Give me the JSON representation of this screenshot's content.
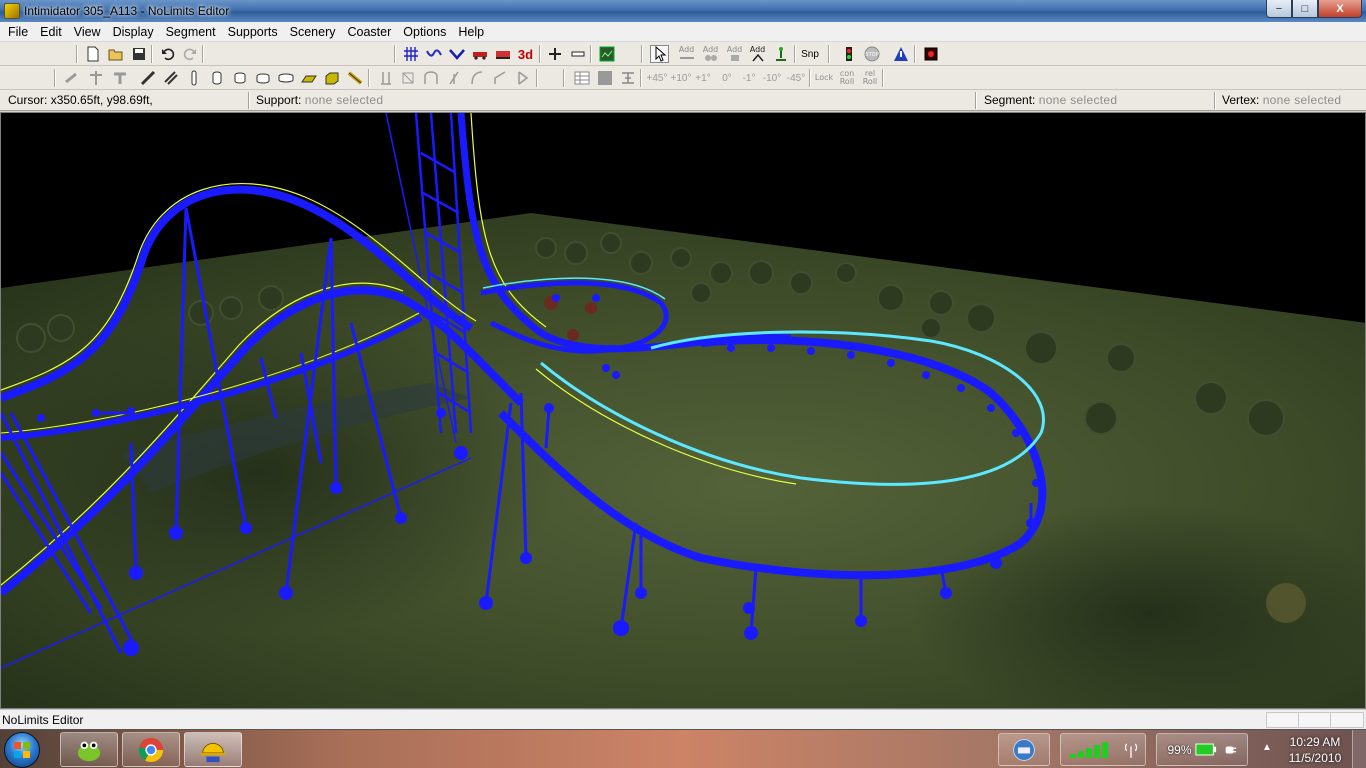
{
  "window": {
    "title": "Intimidator 305_A113 - NoLimits Editor",
    "controls": {
      "minimize": "−",
      "maximize": "□",
      "close": "X"
    }
  },
  "menu": [
    "File",
    "Edit",
    "View",
    "Display",
    "Segment",
    "Supports",
    "Scenery",
    "Coaster",
    "Options",
    "Help"
  ],
  "toolbar1": {
    "threed_label": "3d",
    "snp_label": "Snp",
    "add_labels": [
      "Add",
      "Add",
      "Add",
      "Add"
    ]
  },
  "toolbar2": {
    "angles": [
      "+45°",
      "+10°",
      "+1°",
      "0°",
      "-1°",
      "-10°",
      "-45°"
    ],
    "lock_label": "Lock",
    "con_roll_label": "con Roll",
    "rel_roll_label": "rel Roll"
  },
  "info": {
    "cursor_label": "Cursor:",
    "cursor_value": "x350.65ft, y98.69ft,",
    "support_label": "Support:",
    "support_value": "none selected",
    "segment_label": "Segment:",
    "segment_value": "none selected",
    "vertex_label": "Vertex:",
    "vertex_value": "none selected"
  },
  "status": {
    "text": "NoLimits Editor"
  },
  "taskbar": {
    "battery": "99%",
    "time": "10:29 AM",
    "date": "11/5/2010"
  },
  "colors": {
    "track": "#1a1aff",
    "track_highlight": "#e8ff40",
    "track_selected": "#5ee8ff",
    "terrain": "#3b4a26",
    "sky": "#000000"
  }
}
